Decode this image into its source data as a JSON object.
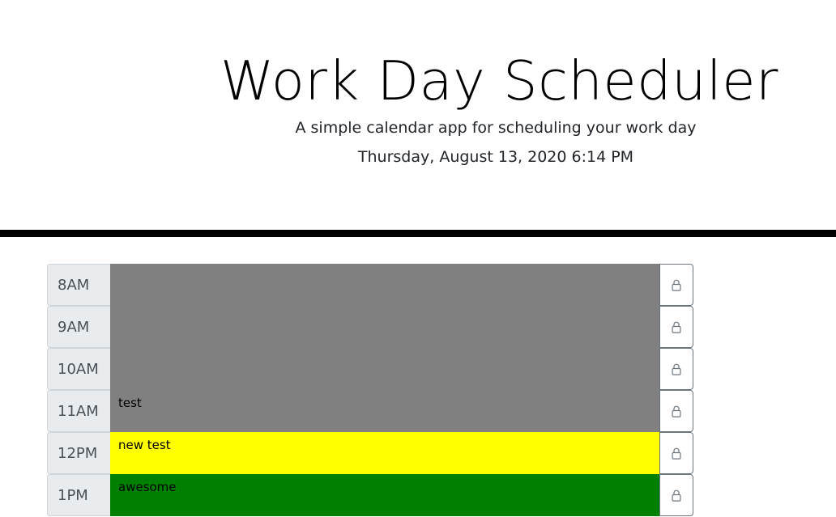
{
  "header": {
    "title": "Work Day Scheduler",
    "subtitle": "A simple calendar app for scheduling your work day",
    "current_day": "Thursday, August 13, 2020 6:14 PM"
  },
  "colors": {
    "past": "#808080",
    "present": "#ffff00",
    "future": "#008000",
    "divider": "#000000"
  },
  "time_blocks": [
    {
      "hour": "8AM",
      "text": "",
      "state": "past"
    },
    {
      "hour": "9AM",
      "text": "",
      "state": "past"
    },
    {
      "hour": "10AM",
      "text": "",
      "state": "past"
    },
    {
      "hour": "11AM",
      "text": "test",
      "state": "past"
    },
    {
      "hour": "12PM",
      "text": "new test",
      "state": "present"
    },
    {
      "hour": "1PM",
      "text": "awesome",
      "state": "future"
    }
  ],
  "save_icon": "lock-icon"
}
